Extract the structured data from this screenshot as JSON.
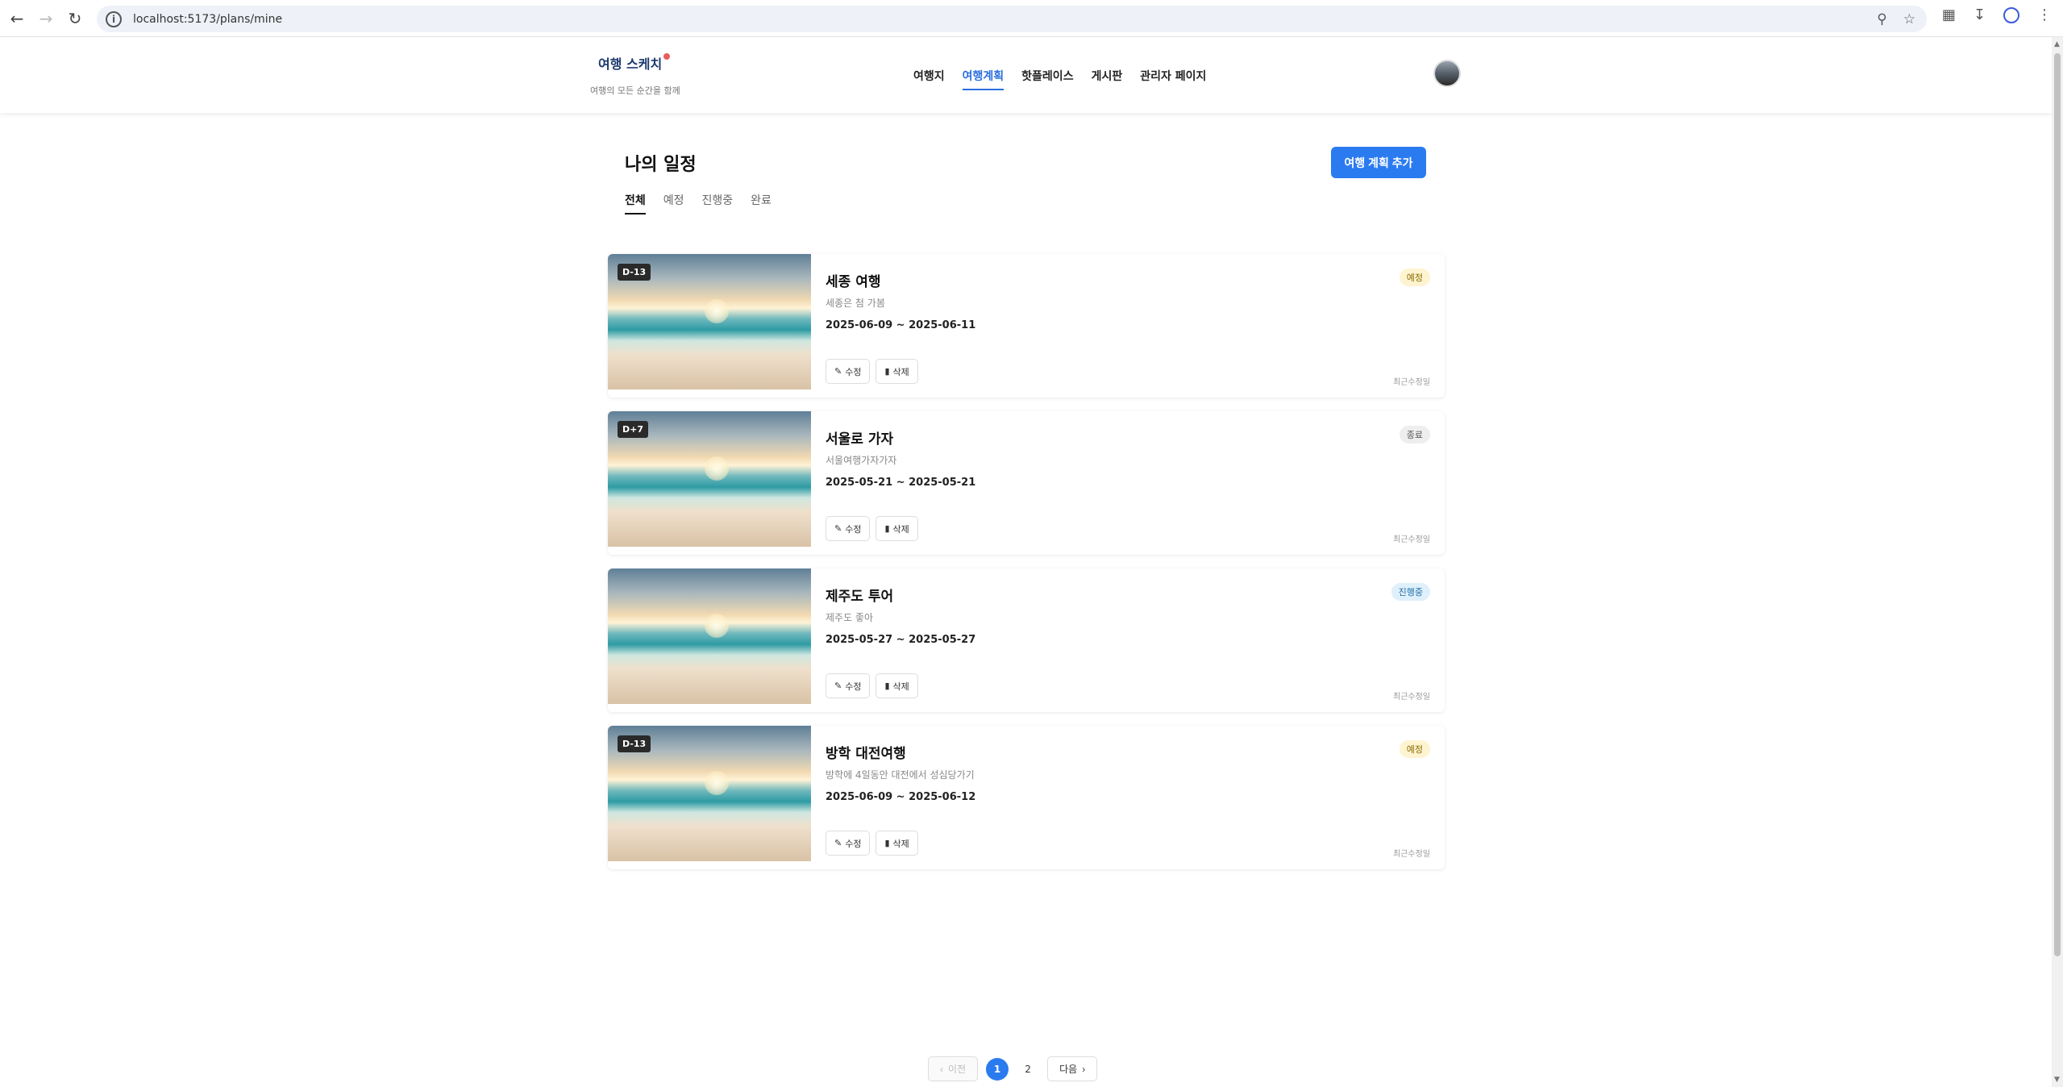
{
  "browser": {
    "url": "localhost:5173/plans/mine"
  },
  "site": {
    "logo_title": "여행 스케치",
    "logo_subtitle": "여행의 모든 순간을 함께",
    "nav": [
      "여행지",
      "여행계획",
      "핫플레이스",
      "게시판",
      "관리자 페이지"
    ],
    "active_nav": "여행계획"
  },
  "page": {
    "title": "나의 일정",
    "tabs": [
      "전체",
      "예정",
      "진행중",
      "완료"
    ],
    "active_tab": "전체",
    "add_button": "여행 계획 추가"
  },
  "plans": [
    {
      "badge": "D-13",
      "title": "세종 여행",
      "description": "세종은 첨 가봄",
      "dates": "2025-06-09 ~ 2025-06-11",
      "status": "예정",
      "status_key": "upcoming",
      "edit_label": "수정",
      "delete_label": "삭제",
      "updated": "최근수정일"
    },
    {
      "badge": "D+7",
      "title": "서울로 가자",
      "description": "서울여행가자가자",
      "dates": "2025-05-21 ~ 2025-05-21",
      "status": "종료",
      "status_key": "done",
      "edit_label": "수정",
      "delete_label": "삭제",
      "updated": "최근수정일"
    },
    {
      "badge": "",
      "title": "제주도 투어",
      "description": "제주도 좋아",
      "dates": "2025-05-27 ~ 2025-05-27",
      "status": "진행중",
      "status_key": "ongoing",
      "edit_label": "수정",
      "delete_label": "삭제",
      "updated": "최근수정일"
    },
    {
      "badge": "D-13",
      "title": "방학 대전여행",
      "description": "방학에 4일동안 대전에서 성심당가기",
      "dates": "2025-06-09 ~ 2025-06-12",
      "status": "예정",
      "status_key": "upcoming",
      "edit_label": "수정",
      "delete_label": "삭제",
      "updated": "최근수정일"
    }
  ],
  "pagination": {
    "prev": "이전",
    "next": "다음",
    "pages": [
      "1",
      "2"
    ],
    "current": "1"
  },
  "colors": {
    "accent": "#2b7bf0",
    "nav_active": "#2b6fe0"
  }
}
